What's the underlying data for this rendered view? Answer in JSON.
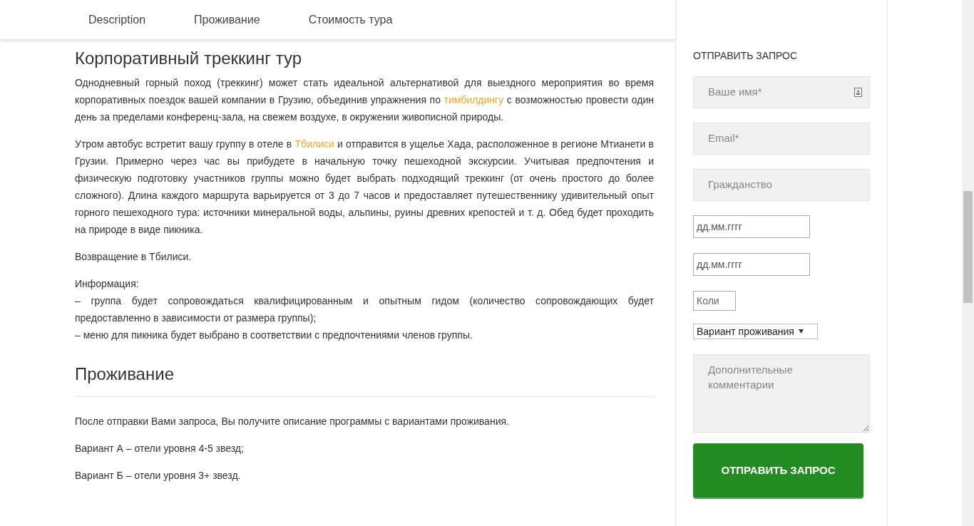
{
  "tabs": [
    {
      "label": "Description",
      "selected": false
    },
    {
      "label": "Проживание",
      "selected": false
    },
    {
      "label": "Стоимость тура",
      "selected": false
    }
  ],
  "sections": [
    {
      "heading": "Корпоративный треккинг тур",
      "blocks": [
        {
          "kind": "paragraph",
          "parts": [
            {
              "kind": "text",
              "text": "Однодневный горный поход (треккинг) может стать идеальной альтернативой для выездного мероприятия во время корпоративных поездок вашей компании в Грузию, объединив упражнения по "
            },
            {
              "kind": "link",
              "text": "тимбилдингу"
            },
            {
              "kind": "text",
              "text": " с возможностью провести один день за пределами конференц-зала, на свежем воздухе, в окружении живописной природы."
            }
          ]
        },
        {
          "kind": "paragraph",
          "parts": [
            {
              "kind": "text",
              "text": "Утром автобус встретит вашу группу в отеле в "
            },
            {
              "kind": "link",
              "text": "Тбилиси"
            },
            {
              "kind": "text",
              "text": " и отправится в ущелье Хада, расположенное в регионе Мтианети в Грузии. Примерно через час вы прибудете в начальную точку пешеходной экскурсии. Учитывая предпочтения и физическую подготовку участников группы можно будет выбрать подходящий треккинг (от очень простого до более сложного). Длина каждого маршрута варьируется от 3 до 7 часов и предоставляет путешественнику удивительный опыт горного пешеходного тура: источники минеральной воды, альпины, руины древних крепостей и т. д. Обед будет проходить на природе в виде пикника."
            }
          ]
        },
        {
          "kind": "paragraph",
          "parts": [
            {
              "kind": "text",
              "text": "Возвращение в Тбилиси."
            }
          ]
        },
        {
          "kind": "lines",
          "lines": [
            "Информация:",
            "– группа будет сопровождаться квалифицированным и опытным гидом (количество сопровождающих будет предоставленно в зависимости от размера группы);",
            "– меню для пикника будет выбрано в соответствии с предпочтениями членов группы."
          ]
        }
      ]
    },
    {
      "heading": "Проживание",
      "blocks": [
        {
          "kind": "divider"
        },
        {
          "kind": "paragraph",
          "parts": [
            {
              "kind": "text",
              "text": "После отправки Вами запроса, Вы получите описание программы с вариантами проживания."
            }
          ]
        },
        {
          "kind": "paragraph",
          "parts": [
            {
              "kind": "text",
              "text": "Вариант А – отели уровня 4-5 звезд;"
            }
          ]
        },
        {
          "kind": "paragraph",
          "parts": [
            {
              "kind": "text",
              "text": "Вариант Б – отели уровня 3+ звезд."
            }
          ]
        }
      ]
    }
  ],
  "form": {
    "title": "ОТПРАВИТЬ ЗАПРОС",
    "fields": [
      {
        "kind": "text",
        "placeholder": "Ваше имя*",
        "contact_icon": true
      },
      {
        "kind": "text",
        "placeholder": "Email*",
        "contact_icon": false
      },
      {
        "kind": "text",
        "placeholder": "Гражданство",
        "contact_icon": false
      },
      {
        "kind": "date",
        "placeholder": "дд.мм.гггг"
      },
      {
        "kind": "date",
        "placeholder": "дд.мм.гггг"
      },
      {
        "kind": "number",
        "placeholder": "Коли"
      },
      {
        "kind": "select",
        "value": "Вариант проживания"
      },
      {
        "kind": "textarea",
        "placeholder": "Дополнительные комментарии"
      }
    ],
    "submit": "ОТПРАВИТЬ ЗАПРОС"
  }
}
